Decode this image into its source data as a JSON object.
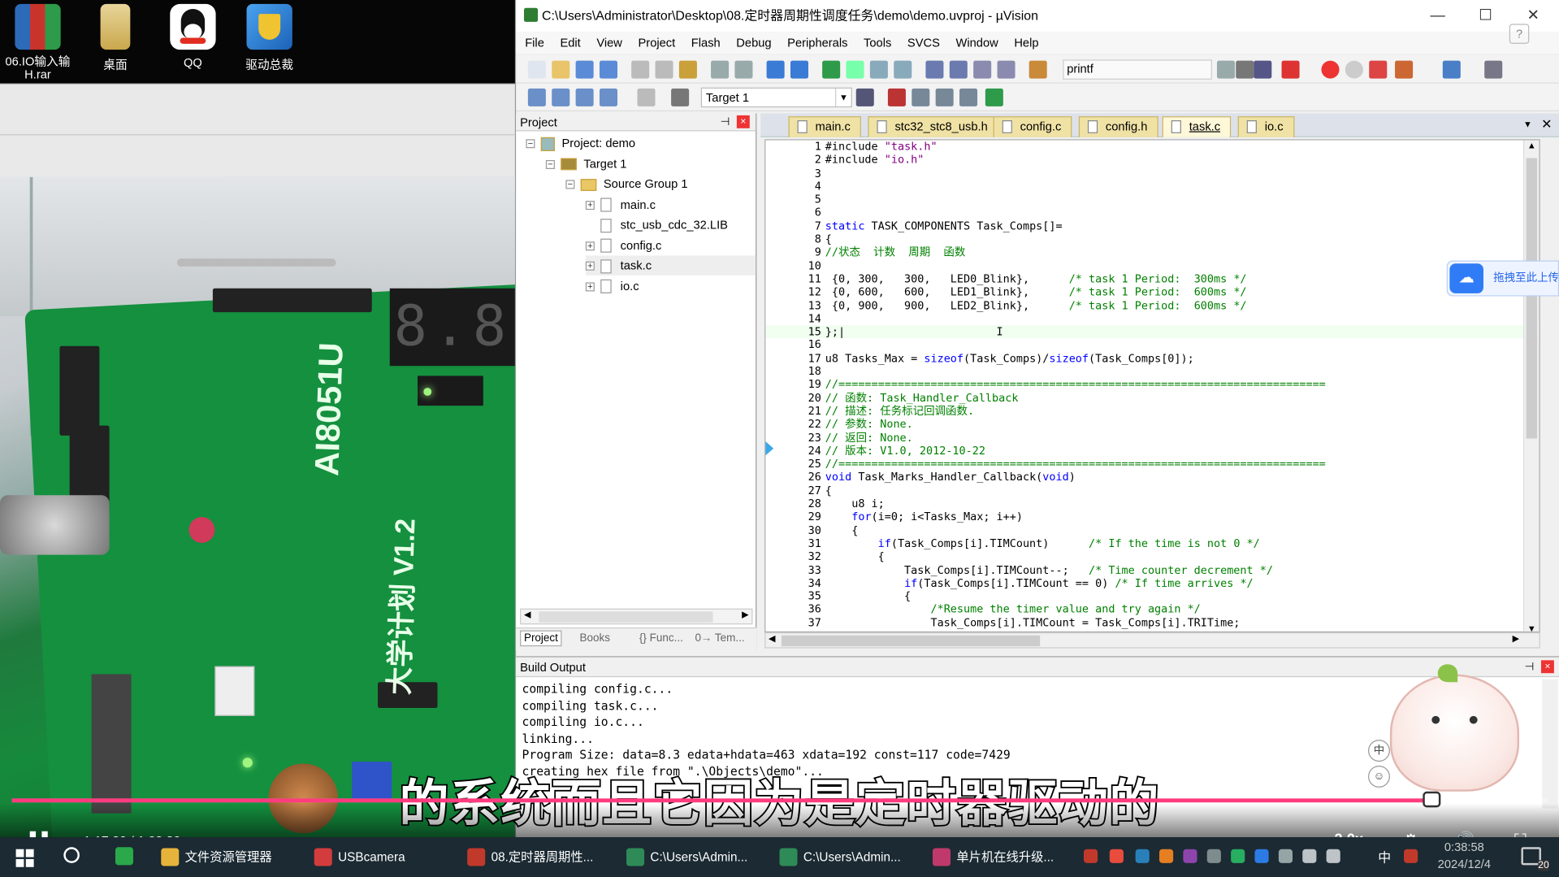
{
  "desktop": {
    "icons": [
      {
        "label": "06.IO输入输\nH.rar",
        "icon": "winrar-icon",
        "color": "#9b2b7a"
      },
      {
        "label": "桌面",
        "icon": "folder-icon",
        "color": "#d7b45a"
      },
      {
        "label": "QQ",
        "icon": "qq-penguin-icon",
        "color": "#ffffff"
      },
      {
        "label": "驱动总裁",
        "icon": "driver-shield-icon",
        "color": "#3a8de0"
      }
    ]
  },
  "photo": {
    "display_digits": "8.8.8.",
    "board_text": "AI8051U",
    "board_text2": "大学计划 V1.2"
  },
  "window": {
    "title": "C:\\Users\\Administrator\\Desktop\\08.定时器周期性调度任务\\demo\\demo.uvproj - µVision",
    "controls": {
      "minimize": "—",
      "maximize": "☐",
      "close": "✕"
    },
    "menu": [
      "File",
      "Edit",
      "View",
      "Project",
      "Flash",
      "Debug",
      "Peripherals",
      "Tools",
      "SVCS",
      "Window",
      "Help"
    ],
    "help_icon": "?",
    "find_text": "printf",
    "target": "Target 1"
  },
  "project": {
    "header": "Project",
    "pin": "⊣",
    "close": "×",
    "tree": [
      {
        "label": "Project: demo",
        "level": 0,
        "expander": "−",
        "icon": "project-icon"
      },
      {
        "label": "Target 1",
        "level": 1,
        "expander": "−",
        "icon": "target-icon"
      },
      {
        "label": "Source Group 1",
        "level": 2,
        "expander": "−",
        "icon": "folder-icon"
      },
      {
        "label": "main.c",
        "level": 3,
        "expander": "+",
        "icon": "file-icon"
      },
      {
        "label": "stc_usb_cdc_32.LIB",
        "level": 3,
        "expander": "",
        "icon": "file-icon"
      },
      {
        "label": "config.c",
        "level": 3,
        "expander": "+",
        "icon": "file-icon"
      },
      {
        "label": "task.c",
        "level": 3,
        "expander": "+",
        "icon": "file-icon",
        "selected": true
      },
      {
        "label": "io.c",
        "level": 3,
        "expander": "+",
        "icon": "file-icon"
      }
    ],
    "bottom_tabs": [
      "Project",
      "Books",
      "{} Func...",
      "0→ Tem..."
    ]
  },
  "editor": {
    "tabs": [
      "main.c",
      "stc32_stc8_usb.h",
      "config.c",
      "config.h",
      "task.c",
      "io.c"
    ],
    "active_tab": "task.c",
    "current_line": 15,
    "lines": [
      {
        "n": "1",
        "html": "#include <span class=\"st\">\"task.h\"</span>"
      },
      {
        "n": "2",
        "html": "#include <span class=\"st\">\"io.h\"</span>"
      },
      {
        "n": "3",
        "html": ""
      },
      {
        "n": "4",
        "html": ""
      },
      {
        "n": "5",
        "html": ""
      },
      {
        "n": "6",
        "html": ""
      },
      {
        "n": "7",
        "html": "<span class=\"kw\">static</span> TASK_COMPONENTS Task_Comps[]="
      },
      {
        "n": "8",
        "html": "{"
      },
      {
        "n": "9",
        "html": "<span class=\"cm\">//状态  计数  周期  函数</span>"
      },
      {
        "n": "10",
        "html": ""
      },
      {
        "n": "11",
        "html": " {0, 300,   300,   LED0_Blink},      <span class=\"cm\">/* task 1 Period:  300ms */</span>"
      },
      {
        "n": "12",
        "html": " {0, 600,   600,   LED1_Blink},      <span class=\"cm\">/* task 1 Period:  600ms */</span>"
      },
      {
        "n": "13",
        "html": " {0, 900,   900,   LED2_Blink},      <span class=\"cm\">/* task 1 Period:  600ms */</span>"
      },
      {
        "n": "14",
        "html": ""
      },
      {
        "n": "15",
        "html": "};|                       I"
      },
      {
        "n": "16",
        "html": ""
      },
      {
        "n": "17",
        "html": "u8 Tasks_Max = <span class=\"kw\">sizeof</span>(Task_Comps)/<span class=\"kw\">sizeof</span>(Task_Comps[0]);"
      },
      {
        "n": "18",
        "html": ""
      },
      {
        "n": "19",
        "html": "<span class=\"cm\">//==========================================================================</span>"
      },
      {
        "n": "20",
        "html": "<span class=\"cm\">// 函数: Task_Handler_Callback</span>"
      },
      {
        "n": "21",
        "html": "<span class=\"cm\">// 描述: 任务标记回调函数.</span>"
      },
      {
        "n": "22",
        "html": "<span class=\"cm\">// 参数: None.</span>"
      },
      {
        "n": "23",
        "html": "<span class=\"cm\">// 返回: None.</span>"
      },
      {
        "n": "24",
        "html": "<span class=\"cm\">// 版本: V1.0, 2012-10-22</span>"
      },
      {
        "n": "25",
        "html": "<span class=\"cm\">//==========================================================================</span>"
      },
      {
        "n": "26",
        "html": "<span class=\"kw\">void</span> Task_Marks_Handler_Callback(<span class=\"kw\">void</span>)"
      },
      {
        "n": "27",
        "html": "{"
      },
      {
        "n": "28",
        "html": "    u8 i;"
      },
      {
        "n": "29",
        "html": "    <span class=\"kw\">for</span>(i=0; i&lt;Tasks_Max; i++)"
      },
      {
        "n": "30",
        "html": "    {"
      },
      {
        "n": "31",
        "html": "        <span class=\"kw\">if</span>(Task_Comps[i].TIMCount)      <span class=\"cm\">/* If the time is not 0 */</span>"
      },
      {
        "n": "32",
        "html": "        {"
      },
      {
        "n": "33",
        "html": "            Task_Comps[i].TIMCount--;   <span class=\"cm\">/* Time counter decrement */</span>"
      },
      {
        "n": "34",
        "html": "            <span class=\"kw\">if</span>(Task_Comps[i].TIMCount == 0) <span class=\"cm\">/* If time arrives */</span>"
      },
      {
        "n": "35",
        "html": "            {"
      },
      {
        "n": "36",
        "html": "                <span class=\"cm\">/*Resume the timer value and try again */</span>"
      },
      {
        "n": "37",
        "html": "                Task_Comps[i].TIMCount = Task_Comps[i].TRITime;"
      }
    ]
  },
  "build": {
    "header": "Build Output",
    "lines": [
      "compiling config.c...",
      "compiling task.c...",
      "compiling io.c...",
      "linking...",
      "Program Size: data=8.3 edata+hdata=463 xdata=192 const=117 code=7429",
      "creating hex file from \".\\Objects\\demo\"..."
    ]
  },
  "overlay": {
    "drag_upload": "拖拽至此上传",
    "side_a": "中",
    "subtitle": "的系统而且它因为是定时器驱动的"
  },
  "player": {
    "current": "1:17:30",
    "separator": "/",
    "total": "1:23:30",
    "progress": 0.925,
    "speed": "2.0x"
  },
  "taskbar": {
    "tasks": [
      {
        "label": "文件资源管理器",
        "color": "#e6b43a"
      },
      {
        "label": "USBcamera",
        "color": "#d23c3c"
      },
      {
        "label": "08.定时器周期性...",
        "color": "#c0392b"
      },
      {
        "label": "C:\\Users\\Admin...",
        "color": "#2e8b57"
      },
      {
        "label": "C:\\Users\\Admin...",
        "color": "#2e8b57"
      },
      {
        "label": "单片机在线升级...",
        "color": "#c0396b"
      }
    ],
    "ime": "中",
    "time": "0:38:58",
    "date": "2024/12/4",
    "notif_count": "20"
  }
}
